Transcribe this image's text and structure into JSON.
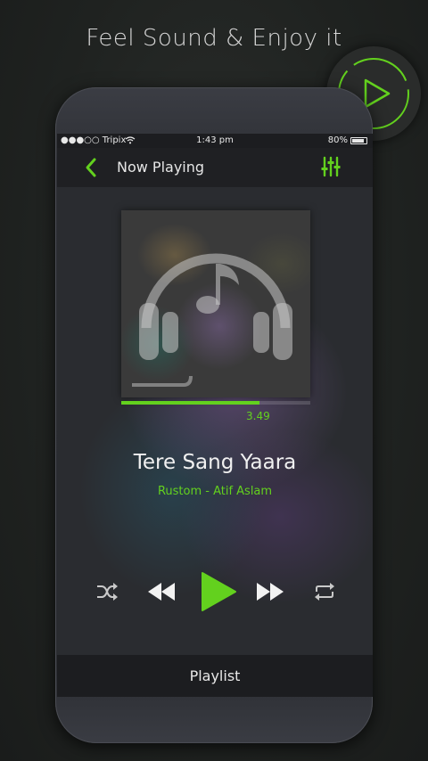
{
  "promo": {
    "tagline": "Feel Sound & Enjoy it"
  },
  "status_bar": {
    "carrier": "●●●○○ Tripix",
    "time": "1:43 pm",
    "battery": "80%"
  },
  "header": {
    "title": "Now Playing"
  },
  "player": {
    "progress_fraction": 0.73,
    "elapsed": "3.49",
    "song_title": "Tere Sang Yaara",
    "song_subtitle": "Rustom - Atif Aslam"
  },
  "bottom": {
    "playlist_label": "Playlist"
  },
  "colors": {
    "accent": "#63d11e",
    "bar": "#1f2023"
  },
  "icons": [
    "play-circle-icon",
    "wifi-icon",
    "battery-icon",
    "back-chevron-icon",
    "equalizer-icon",
    "headphones-music-icon",
    "shuffle-icon",
    "rewind-icon",
    "play-icon",
    "fast-forward-icon",
    "repeat-icon"
  ]
}
